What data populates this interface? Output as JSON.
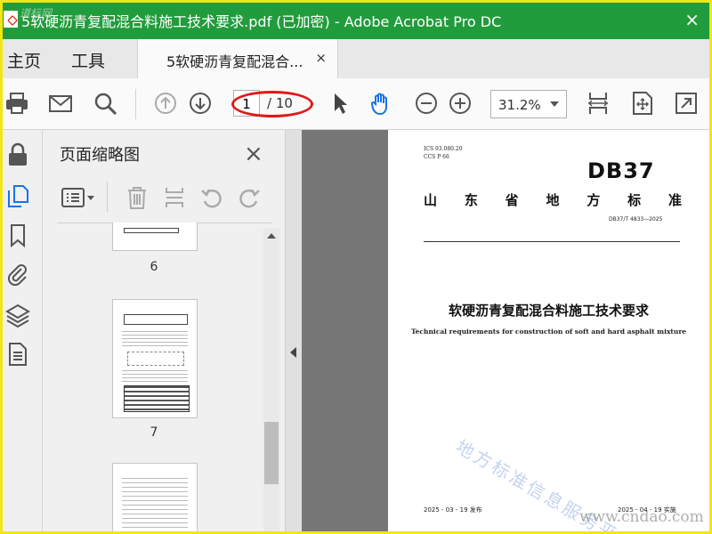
{
  "titlebar": {
    "title": "5软硬沥青复配混合料施工技术要求.pdf  (已加密)  - Adobe Acrobat Pro DC",
    "watermark": "道标网",
    "close": "×"
  },
  "menu": {
    "home": "主页",
    "tools": "工具"
  },
  "tab": {
    "label": "5软硬沥青复配混合...",
    "close": "×"
  },
  "toolbar": {
    "page_current": "1",
    "page_total": "/ 10",
    "zoom": "31.2%",
    "icons": [
      "print-icon",
      "mail-icon",
      "search-icon",
      "page-up-icon",
      "page-down-icon",
      "select-pointer-icon",
      "hand-tool-icon",
      "zoom-out-icon",
      "zoom-in-icon",
      "fit-width-icon",
      "interactive-fit-icon",
      "fullscreen-icon"
    ]
  },
  "rail": {
    "icons": [
      "lock-icon",
      "pages-icon",
      "bookmark-icon",
      "attachment-icon",
      "layers-icon",
      "document-icon"
    ]
  },
  "panel": {
    "title": "页面缩略图",
    "close": "×",
    "thumbnails": [
      {
        "label": "6"
      },
      {
        "label": "7"
      }
    ]
  },
  "document": {
    "ics": "ICS  93.080.20",
    "ccs": "CCS P 66",
    "standard": "DB37",
    "province": [
      "山",
      "东",
      "省",
      "地",
      "方",
      "标",
      "准"
    ],
    "code": "DB37/T 4833—2025",
    "title_zh": "软硬沥青复配混合料施工技术要求",
    "title_en": "Technical requirements for construction of soft and hard asphalt mixture",
    "issue": "2025 - 03 - 19 发布",
    "implement": "2025 - 04 - 19 实施",
    "watermark": "地方标准信息服务平台"
  },
  "site_watermark": "www.cndao.com",
  "colors": {
    "titlebar": "#219c3c",
    "frame": "#f2e614",
    "annotation": "#e01818",
    "hand_tool": "#1a73e8"
  }
}
